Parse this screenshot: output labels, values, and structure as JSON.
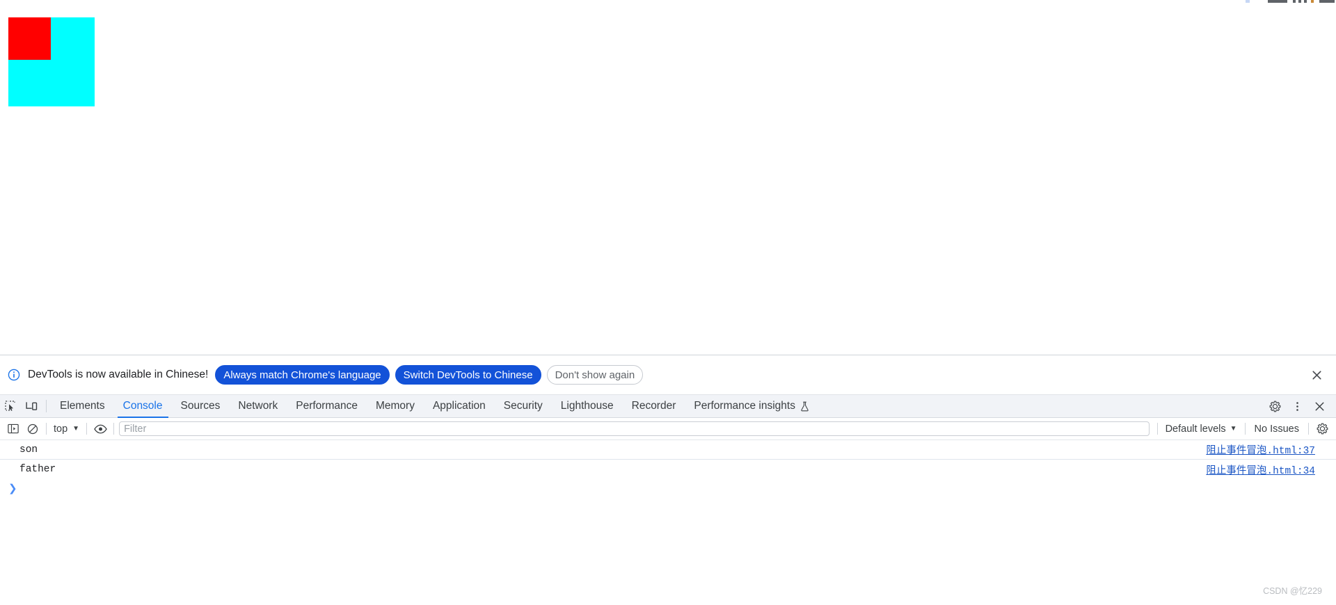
{
  "page": {
    "outer_box": {
      "color": "#00ffff",
      "name": "cyan-outer-box"
    },
    "inner_box": {
      "color": "#ff0000",
      "name": "red-inner-box"
    }
  },
  "infobar": {
    "icon": "info-circle-icon",
    "message": "DevTools is now available in Chinese!",
    "buttons": [
      {
        "label": "Always match Chrome's language",
        "style": "primary"
      },
      {
        "label": "Switch DevTools to Chinese",
        "style": "primary"
      },
      {
        "label": "Don't show again",
        "style": "ghost"
      }
    ],
    "close_icon": "close-icon",
    "accent": "#1352d8"
  },
  "tabbar": {
    "left_icons": [
      "inspect-element-icon",
      "device-toolbar-icon"
    ],
    "tabs": [
      {
        "label": "Elements",
        "active": false
      },
      {
        "label": "Console",
        "active": true
      },
      {
        "label": "Sources",
        "active": false
      },
      {
        "label": "Network",
        "active": false
      },
      {
        "label": "Performance",
        "active": false
      },
      {
        "label": "Memory",
        "active": false
      },
      {
        "label": "Application",
        "active": false
      },
      {
        "label": "Security",
        "active": false
      },
      {
        "label": "Lighthouse",
        "active": false
      },
      {
        "label": "Recorder",
        "active": false
      },
      {
        "label": "Performance insights",
        "active": false,
        "icon": "flask-icon"
      }
    ],
    "right_icons": [
      "gear-icon",
      "more-options-icon",
      "close-devtools-icon"
    ],
    "active_color": "#1a73e8"
  },
  "console_toolbar": {
    "sidebar_toggle_icon": "console-sidebar-toggle-icon",
    "clear_icon": "clear-console-icon",
    "context": "top",
    "context_caret": "▼",
    "eye_icon": "live-expressions-eye-icon",
    "filter_placeholder": "Filter",
    "filter_value": "",
    "levels_label": "Default levels",
    "levels_caret": "▼",
    "issues_label": "No Issues",
    "settings_icon": "console-settings-gear-icon"
  },
  "console_messages": [
    {
      "text": "son",
      "source": "阻止事件冒泡.html:37"
    },
    {
      "text": "father",
      "source": "阻止事件冒泡.html:34"
    }
  ],
  "prompt": {
    "caret": "❯",
    "value": ""
  },
  "watermark": "CSDN @忆229"
}
